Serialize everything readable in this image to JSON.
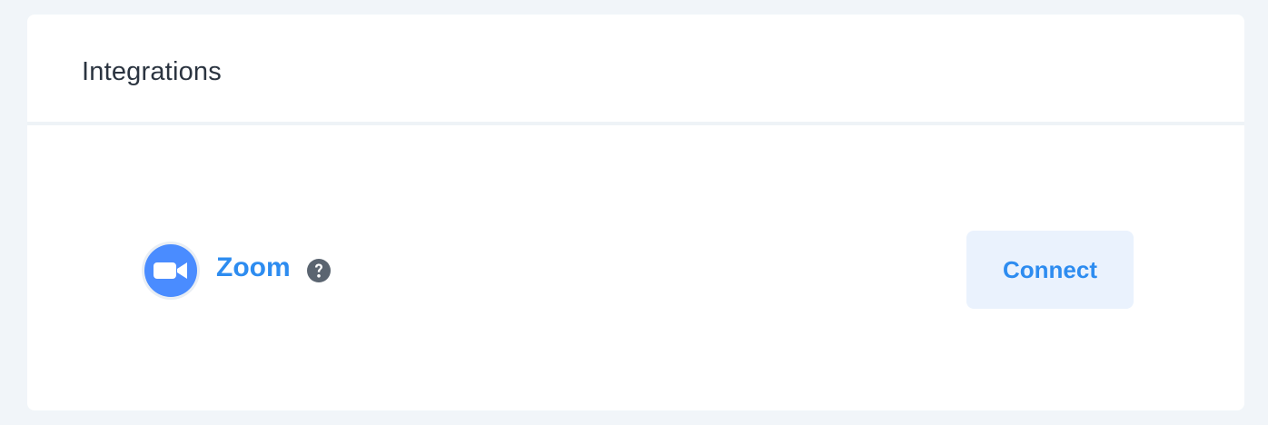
{
  "card": {
    "title": "Integrations"
  },
  "integrations": [
    {
      "name": "Zoom",
      "icon": "video-camera-icon",
      "help_icon": "question-circle-icon",
      "action_label": "Connect"
    }
  ],
  "colors": {
    "page_background": "#f1f5f9",
    "accent": "#2d8cf0",
    "zoom_brand": "#4a8cff",
    "button_background": "#eaf2fd",
    "help_icon": "#5a6470"
  }
}
